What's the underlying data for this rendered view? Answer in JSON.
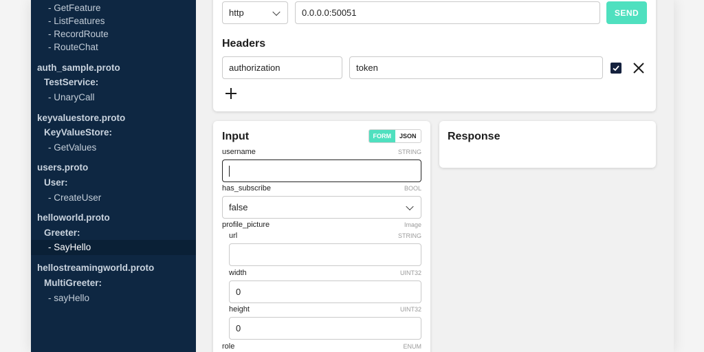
{
  "sidebar": {
    "items": [
      {
        "kind": "method",
        "label": "- GetFeature"
      },
      {
        "kind": "method",
        "label": "- ListFeatures"
      },
      {
        "kind": "method",
        "label": "- RecordRoute"
      },
      {
        "kind": "method",
        "label": "- RouteChat"
      },
      {
        "kind": "proto",
        "label": "auth_sample.proto"
      },
      {
        "kind": "service",
        "label": "TestService:"
      },
      {
        "kind": "method",
        "label": "- UnaryCall"
      },
      {
        "kind": "proto",
        "label": "keyvaluestore.proto"
      },
      {
        "kind": "service",
        "label": "KeyValueStore:"
      },
      {
        "kind": "method",
        "label": "- GetValues"
      },
      {
        "kind": "proto",
        "label": "users.proto"
      },
      {
        "kind": "service",
        "label": "User:"
      },
      {
        "kind": "method",
        "label": "- CreateUser"
      },
      {
        "kind": "proto",
        "label": "helloworld.proto"
      },
      {
        "kind": "service",
        "label": "Greeter:"
      },
      {
        "kind": "method",
        "label": "- SayHello",
        "selected": true
      },
      {
        "kind": "proto",
        "label": "hellostreamingworld.proto"
      },
      {
        "kind": "service",
        "label": "MultiGreeter:"
      },
      {
        "kind": "method",
        "label": "- sayHello"
      }
    ]
  },
  "request": {
    "protocol": "http",
    "address": "0.0.0.0:50051",
    "send_label": "SEND"
  },
  "headers": {
    "title": "Headers",
    "key": "authorization",
    "value": "token",
    "enabled": true
  },
  "input": {
    "title": "Input",
    "mode_form": "FORM",
    "mode_json": "JSON",
    "active_mode": "FORM",
    "fields": {
      "username": {
        "label": "username",
        "type": "STRING",
        "value": ""
      },
      "has_subscribe": {
        "label": "has_subscribe",
        "type": "BOOL",
        "value": "false"
      },
      "profile_picture": {
        "label": "profile_picture",
        "type": "Image"
      },
      "url": {
        "label": "url",
        "type": "STRING",
        "value": ""
      },
      "width": {
        "label": "width",
        "type": "UINT32",
        "value": "0"
      },
      "height": {
        "label": "height",
        "type": "UINT32",
        "value": "0"
      },
      "role": {
        "label": "role",
        "type": "ENUM"
      }
    }
  },
  "response": {
    "title": "Response"
  },
  "colors": {
    "sidebar_bg": "#0e2742",
    "accent": "#4fe0bf",
    "checkbox": "#14213d"
  }
}
